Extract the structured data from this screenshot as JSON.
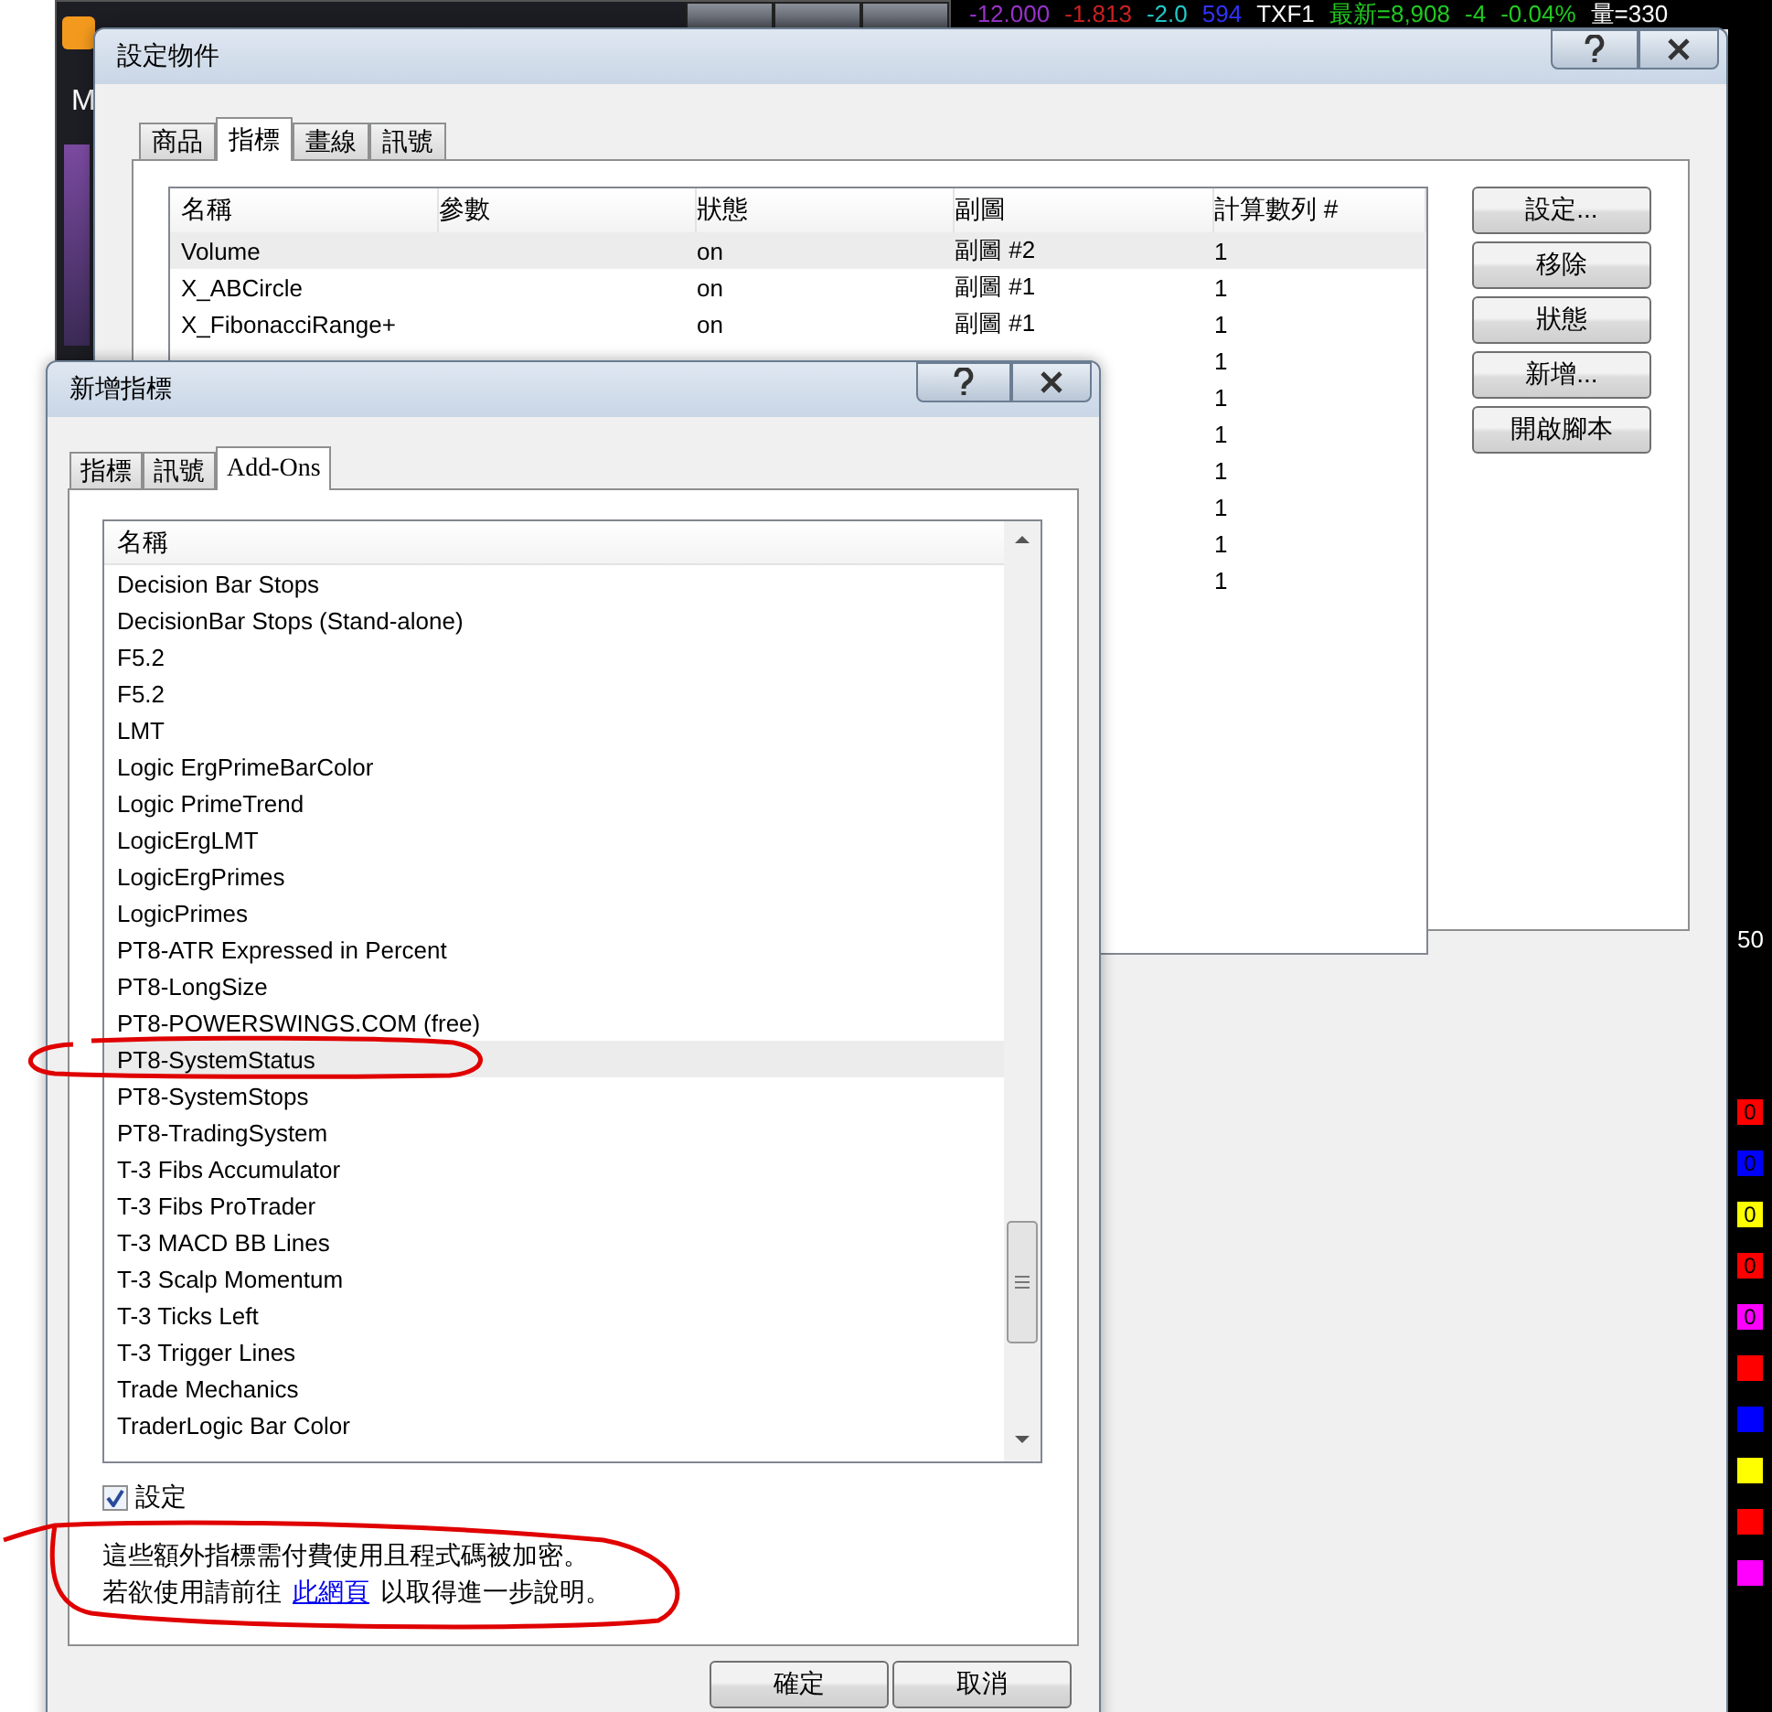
{
  "ticker": [
    {
      "text": "-12.000",
      "color": "#9933cc"
    },
    {
      "text": "-1.813",
      "color": "#cc2222"
    },
    {
      "text": "-2.0",
      "color": "#22cccc"
    },
    {
      "text": "594",
      "color": "#3333ff"
    },
    {
      "text": "TXF1",
      "color": "#ffffff"
    },
    {
      "text": "最新=8,908",
      "color": "#22cc22"
    },
    {
      "text": "-4",
      "color": "#22cc22"
    },
    {
      "text": "-0.04%",
      "color": "#22cc22"
    },
    {
      "text": "量=330",
      "color": "#ffffff"
    }
  ],
  "app": {
    "label": "M",
    "axis_label": "50"
  },
  "side_blocks": [
    {
      "color": "#ff0000",
      "text": "0"
    },
    {
      "color": "#0000ff",
      "text": "0"
    },
    {
      "color": "#ffff00",
      "text": "0"
    },
    {
      "color": "#ff0000",
      "text": "0"
    },
    {
      "color": "#ff00ff",
      "text": "0"
    },
    {
      "color": "#ff0000"
    },
    {
      "color": "#0000ff"
    },
    {
      "color": "#ffff00"
    },
    {
      "color": "#ff0000"
    },
    {
      "color": "#ff00ff"
    }
  ],
  "settings_dialog": {
    "title": "設定物件",
    "tabs": [
      {
        "label": "商品",
        "selected": false
      },
      {
        "label": "指標",
        "selected": true
      },
      {
        "label": "畫線",
        "selected": false
      },
      {
        "label": "訊號",
        "selected": false
      }
    ],
    "columns": [
      "名稱",
      "參數",
      "狀態",
      "副圖",
      "計算數列 #"
    ],
    "rows": [
      {
        "name": "Volume",
        "params": "",
        "status": "on",
        "subchart": "副圖 #2",
        "series": "1",
        "selected": true
      },
      {
        "name": "X_ABCircle",
        "params": "",
        "status": "on",
        "subchart": "副圖 #1",
        "series": "1",
        "selected": false
      },
      {
        "name": "X_FibonacciRange+",
        "params": "",
        "status": "on",
        "subchart": "副圖 #1",
        "series": "1",
        "selected": false
      },
      {
        "series": "1",
        "selected": false
      },
      {
        "series": "1",
        "selected": false
      },
      {
        "series": "1",
        "selected": false
      },
      {
        "series": "1",
        "selected": false
      },
      {
        "series": "1",
        "selected": false
      },
      {
        "series": "1",
        "selected": false
      },
      {
        "series": "1",
        "selected": false
      }
    ],
    "buttons": [
      "設定...",
      "移除",
      "狀態",
      "新增...",
      "開啟腳本"
    ]
  },
  "add_dialog": {
    "title": "新增指標",
    "tabs": [
      {
        "label": "指標",
        "selected": false
      },
      {
        "label": "訊號",
        "selected": false
      },
      {
        "label": "Add-Ons",
        "selected": true
      }
    ],
    "column": "名稱",
    "items": [
      {
        "label": "Decision Bar Stops",
        "selected": false
      },
      {
        "label": "DecisionBar Stops (Stand-alone)",
        "selected": false
      },
      {
        "label": "F5.2",
        "selected": false
      },
      {
        "label": "F5.2",
        "selected": false
      },
      {
        "label": "LMT",
        "selected": false
      },
      {
        "label": "Logic ErgPrimeBarColor",
        "selected": false
      },
      {
        "label": "Logic PrimeTrend",
        "selected": false
      },
      {
        "label": "LogicErgLMT",
        "selected": false
      },
      {
        "label": "LogicErgPrimes",
        "selected": false
      },
      {
        "label": "LogicPrimes",
        "selected": false
      },
      {
        "label": "PT8-ATR Expressed in Percent",
        "selected": false
      },
      {
        "label": "PT8-LongSize",
        "selected": false
      },
      {
        "label": "PT8-POWERSWINGS.COM (free)",
        "selected": false
      },
      {
        "label": "PT8-SystemStatus",
        "selected": true
      },
      {
        "label": "PT8-SystemStops",
        "selected": false
      },
      {
        "label": "PT8-TradingSystem",
        "selected": false
      },
      {
        "label": "T-3 Fibs Accumulator",
        "selected": false
      },
      {
        "label": "T-3 Fibs ProTrader",
        "selected": false
      },
      {
        "label": "T-3 MACD BB Lines",
        "selected": false
      },
      {
        "label": "T-3 Scalp Momentum",
        "selected": false
      },
      {
        "label": "T-3 Ticks Left",
        "selected": false
      },
      {
        "label": "T-3 Trigger Lines",
        "selected": false
      },
      {
        "label": "Trade Mechanics",
        "selected": false
      },
      {
        "label": "TraderLogic Bar Color",
        "selected": false
      }
    ],
    "checkbox": {
      "label": "設定",
      "checked": true
    },
    "note_line_1": "這些額外指標需付費使用且程式碼被加密。",
    "note_line_2_before": "若欲使用請前往",
    "note_link": "此網頁",
    "note_line_2_after": "以取得進一步說明。",
    "buttons": [
      "確定",
      "取消"
    ]
  }
}
